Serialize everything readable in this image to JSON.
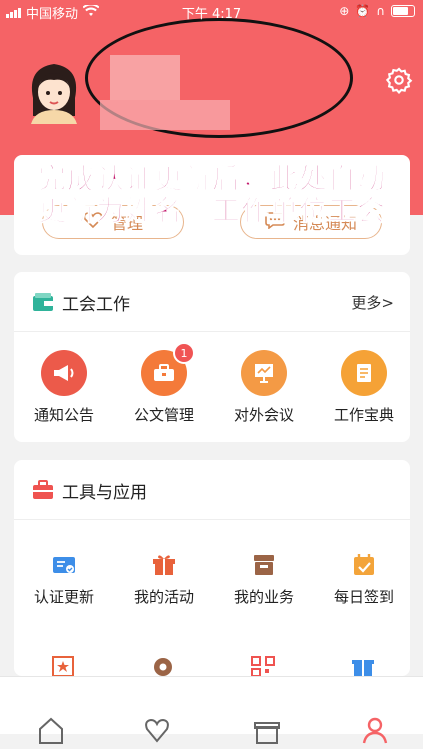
{
  "status": {
    "carrier": "中国移动",
    "time": "下午 4:17"
  },
  "quick_actions": [
    {
      "label": "管理"
    },
    {
      "label": "消息通知"
    }
  ],
  "overlay": {
    "line1": "完成认证更新后，此处自动",
    "line2": "更新为姓名＋工作单位工会",
    "color": "#c3196d"
  },
  "union_work": {
    "title": "工会工作",
    "more": "更多>",
    "items": [
      {
        "label": "通知公告",
        "icon": "megaphone-icon",
        "color": "#ec5a4a"
      },
      {
        "label": "公文管理",
        "icon": "briefcase-icon",
        "color": "#f47a3a",
        "badge": "1"
      },
      {
        "label": "对外会议",
        "icon": "presentation-icon",
        "color": "#f49a45"
      },
      {
        "label": "工作宝典",
        "icon": "book-icon",
        "color": "#f5a236"
      }
    ]
  },
  "tools": {
    "title": "工具与应用",
    "items": [
      {
        "label": "认证更新",
        "icon": "id-card-icon",
        "color": "#3d8ee8"
      },
      {
        "label": "我的活动",
        "icon": "gift-icon",
        "color": "#e8623b"
      },
      {
        "label": "我的业务",
        "icon": "archive-icon",
        "color": "#9b6446"
      },
      {
        "label": "每日签到",
        "icon": "calendar-check-icon",
        "color": "#f3a43a"
      }
    ]
  },
  "colors": {
    "header": "#f56366",
    "accent_orange": "#d58a56"
  }
}
